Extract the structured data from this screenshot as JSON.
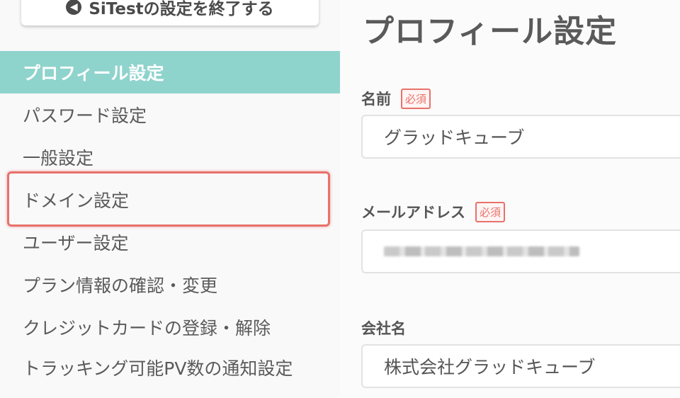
{
  "sidebar": {
    "exit_label": "SiTestの設定を終了する",
    "items": [
      {
        "label": "プロフィール設定",
        "active": true
      },
      {
        "label": "パスワード設定"
      },
      {
        "label": "一般設定"
      },
      {
        "label": "ドメイン設定"
      },
      {
        "label": "ユーザー設定"
      },
      {
        "label": "プラン情報の確認・変更"
      },
      {
        "label": "クレジットカードの登録・解除"
      },
      {
        "label": "トラッキング可能PV数の通知設定"
      }
    ]
  },
  "main": {
    "title": "プロフィール設定",
    "required_badge": "必須",
    "fields": {
      "name": {
        "label": "名前",
        "value": "グラッドキューブ"
      },
      "email": {
        "label": "メールアドレス"
      },
      "company": {
        "label": "会社名",
        "value": "株式会社グラッドキューブ"
      }
    }
  },
  "colors": {
    "active_bg": "#8fd3cd",
    "highlight": "#e8716b",
    "required": "#e8716b"
  }
}
